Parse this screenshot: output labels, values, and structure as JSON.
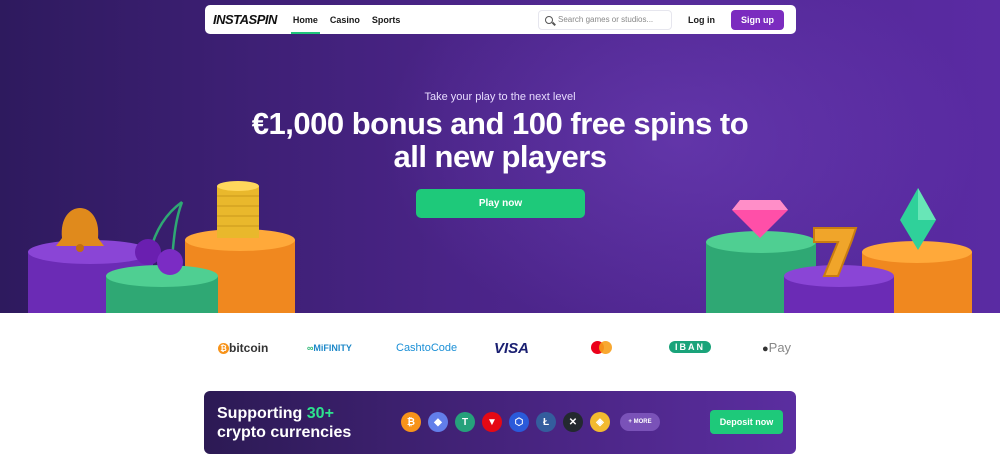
{
  "nav": {
    "logo": "INSTASPIN",
    "links": [
      {
        "label": "Home",
        "active": true
      },
      {
        "label": "Casino",
        "active": false
      },
      {
        "label": "Sports",
        "active": false
      }
    ],
    "search_placeholder": "Search games or studios...",
    "login_label": "Log in",
    "signup_label": "Sign up"
  },
  "hero": {
    "tagline": "Take your play to the next level",
    "headline": "€1,000 bonus and 100 free spins to all new players",
    "cta_label": "Play now"
  },
  "payments": [
    {
      "name": "bitcoin",
      "label": "bitcoin"
    },
    {
      "name": "mifinity",
      "label": "MiFINITY"
    },
    {
      "name": "cashtocode",
      "label": "CashtoCode"
    },
    {
      "name": "visa",
      "label": "VISA"
    },
    {
      "name": "mastercard",
      "label": ""
    },
    {
      "name": "iban",
      "label": "IBAN"
    },
    {
      "name": "apple-pay",
      "label": "Pay"
    }
  ],
  "crypto": {
    "title_part1": "Supporting",
    "title_highlight": "30+",
    "title_part2": "crypto currencies",
    "coins": [
      {
        "name": "bitcoin-coin-icon",
        "glyph": "₿",
        "color": "#f7931a"
      },
      {
        "name": "ethereum-coin-icon",
        "glyph": "◆",
        "color": "#627eea"
      },
      {
        "name": "tether-coin-icon",
        "glyph": "T",
        "color": "#26a17b"
      },
      {
        "name": "tron-coin-icon",
        "glyph": "▼",
        "color": "#e50914"
      },
      {
        "name": "chainlink-coin-icon",
        "glyph": "⬡",
        "color": "#2a5ada"
      },
      {
        "name": "litecoin-coin-icon",
        "glyph": "Ł",
        "color": "#345d9d"
      },
      {
        "name": "xrp-coin-icon",
        "glyph": "✕",
        "color": "#23292f"
      },
      {
        "name": "bnb-coin-icon",
        "glyph": "◈",
        "color": "#f3ba2f"
      }
    ],
    "more_label": "+ MORE",
    "deposit_label": "Deposit now"
  },
  "colors": {
    "accent_green": "#1ec97a",
    "brand_purple": "#7b2cbf",
    "hero_bg": "#4a2487"
  }
}
